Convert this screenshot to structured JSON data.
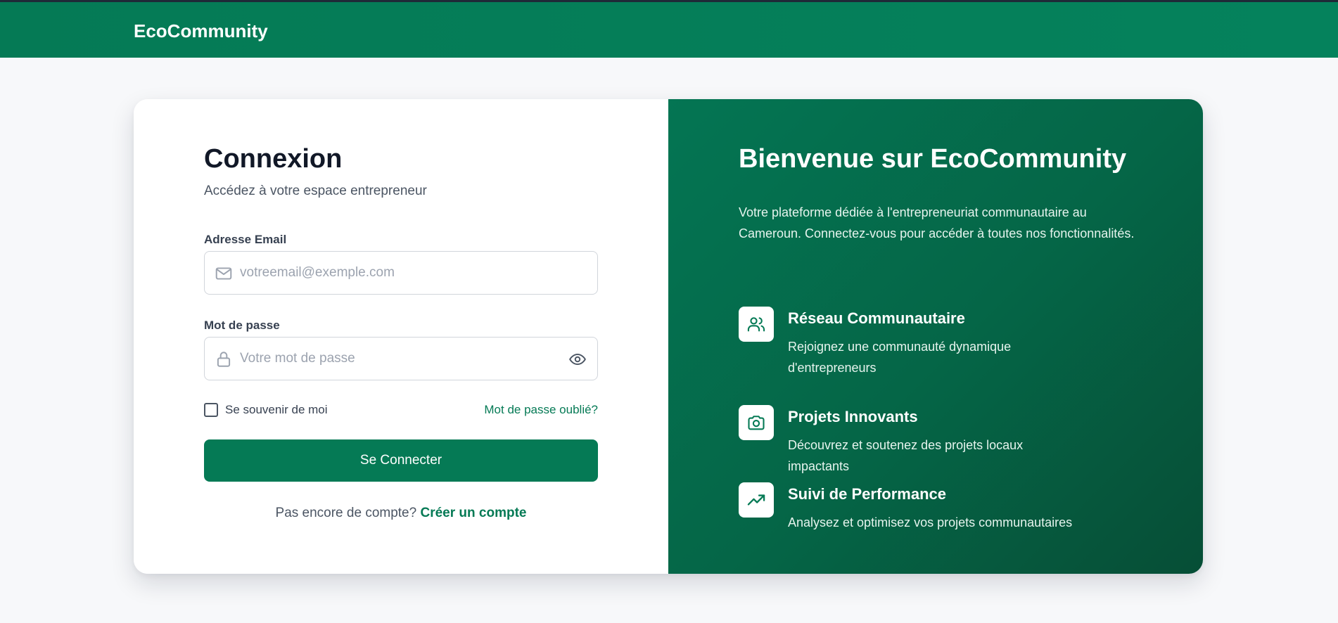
{
  "header": {
    "brand": "EcoCommunity"
  },
  "login": {
    "title": "Connexion",
    "subtitle": "Accédez à votre espace entrepreneur",
    "email": {
      "label": "Adresse Email",
      "placeholder": "votreemail@exemple.com",
      "value": ""
    },
    "password": {
      "label": "Mot de passe",
      "placeholder": "Votre mot de passe",
      "value": ""
    },
    "remember_label": "Se souvenir de moi",
    "remember_checked": false,
    "forgot_link": "Mot de passe oublié?",
    "submit_label": "Se Connecter",
    "signup_prompt": "Pas encore de compte?",
    "signup_link": "Créer un compte"
  },
  "promo": {
    "title": "Bienvenue sur EcoCommunity",
    "description": "Votre plateforme dédiée à l'entrepreneuriat communautaire au Cameroun. Connectez-vous pour accéder à toutes nos fonctionnalités.",
    "features": [
      {
        "icon": "users-icon",
        "title": "Réseau Communautaire",
        "text": "Rejoignez une communauté dynamique d'entrepreneurs"
      },
      {
        "icon": "camera-icon",
        "title": "Projets Innovants",
        "text": "Découvrez et soutenez des projets locaux impactants"
      },
      {
        "icon": "trending-up-icon",
        "title": "Suivi de Performance",
        "text": "Analysez et optimisez vos projets communautaires"
      }
    ]
  },
  "colors": {
    "primary": "#057a55",
    "primary_dark": "#064e36",
    "page_background": "#f7f8fa",
    "heading": "#111827",
    "muted_text": "#4b5563"
  }
}
